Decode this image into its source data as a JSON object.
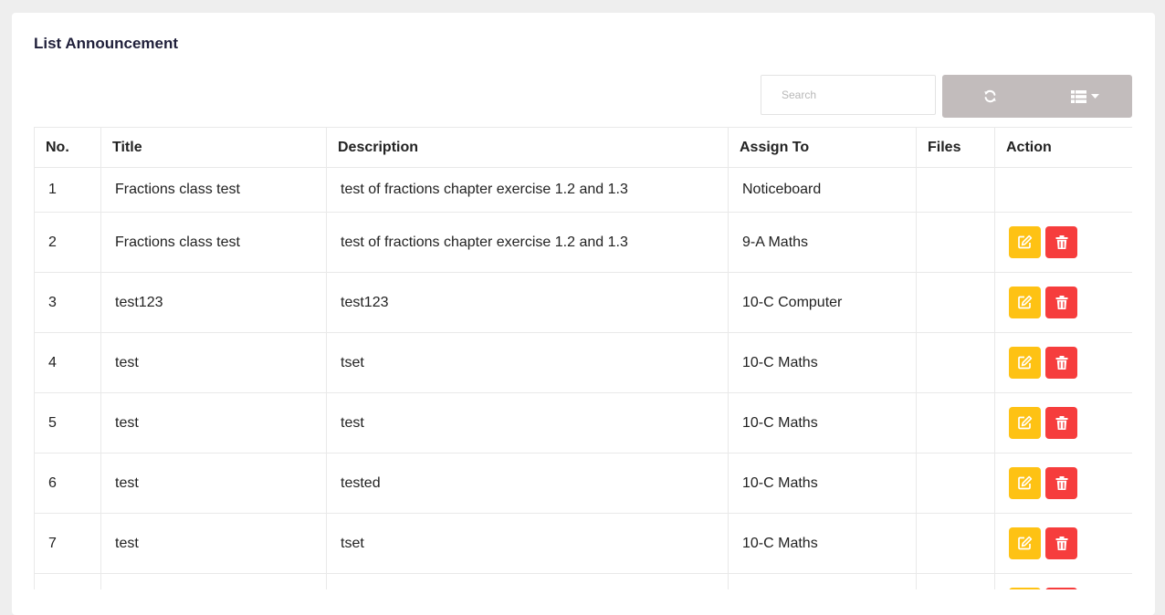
{
  "page": {
    "title": "List Announcement"
  },
  "search": {
    "placeholder": "Search",
    "value": ""
  },
  "toolbar": {
    "refresh_icon": "refresh-icon",
    "columns_icon": "list-columns-icon"
  },
  "colors": {
    "toolbar_bg": "#c2bcbc",
    "edit": "#fec214",
    "delete": "#f63d3d"
  },
  "table": {
    "headers": [
      "No.",
      "Title",
      "Description",
      "Assign To",
      "Files",
      "Action"
    ],
    "rows": [
      {
        "no": "1",
        "title": "Fractions class test",
        "description": "test of fractions chapter exercise 1.2 and 1.3",
        "assign_to": "Noticeboard",
        "files": "",
        "actions": false
      },
      {
        "no": "2",
        "title": "Fractions class test",
        "description": "test of fractions chapter exercise 1.2 and 1.3",
        "assign_to": "9-A Maths",
        "files": "",
        "actions": true
      },
      {
        "no": "3",
        "title": "test123",
        "description": "test123",
        "assign_to": "10-C Computer",
        "files": "",
        "actions": true
      },
      {
        "no": "4",
        "title": "test",
        "description": "tset",
        "assign_to": "10-C Maths",
        "files": "",
        "actions": true
      },
      {
        "no": "5",
        "title": "test",
        "description": "test",
        "assign_to": "10-C Maths",
        "files": "",
        "actions": true
      },
      {
        "no": "6",
        "title": "test",
        "description": "tested",
        "assign_to": "10-C Maths",
        "files": "",
        "actions": true
      },
      {
        "no": "7",
        "title": "test",
        "description": "tset",
        "assign_to": "10-C Maths",
        "files": "",
        "actions": true
      },
      {
        "no": "",
        "title": "",
        "description": "",
        "assign_to": "",
        "files": "",
        "actions": true
      }
    ]
  }
}
